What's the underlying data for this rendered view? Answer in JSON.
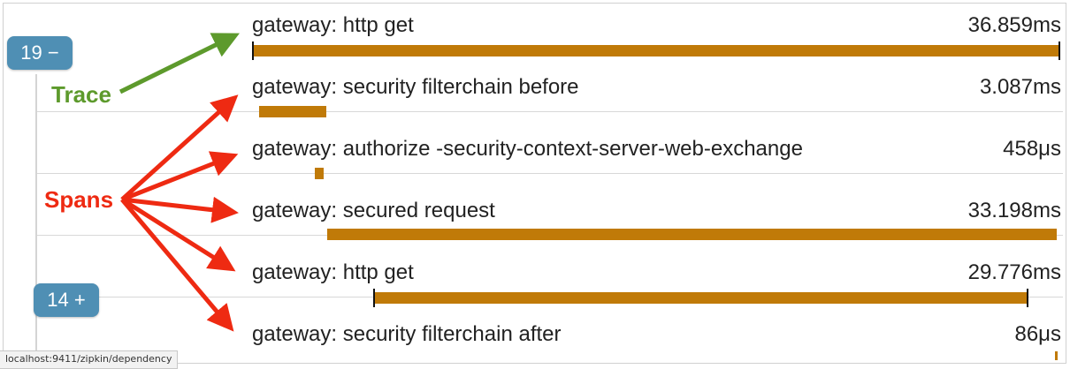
{
  "trace_view": {
    "badges": [
      {
        "label": "19 −"
      },
      {
        "label": "14 +"
      }
    ],
    "spans": [
      {
        "name": "gateway: http get",
        "duration": "36.859ms"
      },
      {
        "name": "gateway: security filterchain before",
        "duration": "3.087ms"
      },
      {
        "name": "gateway: authorize -security-context-server-web-exchange",
        "duration": "458μs"
      },
      {
        "name": "gateway: secured request",
        "duration": "33.198ms"
      },
      {
        "name": "gateway: http get",
        "duration": "29.776ms"
      },
      {
        "name": "gateway: security filterchain after",
        "duration": "86μs"
      }
    ]
  },
  "annotations": {
    "trace": "Trace",
    "spans": "Spans"
  },
  "status_bar": {
    "url": "localhost:9411/zipkin/dependency"
  },
  "colors": {
    "bar": "#c07a08",
    "badge": "#4f8fb4",
    "trace_annotation": "#5d9a2c",
    "spans_annotation": "#ee2a12",
    "tick": "#111111"
  }
}
